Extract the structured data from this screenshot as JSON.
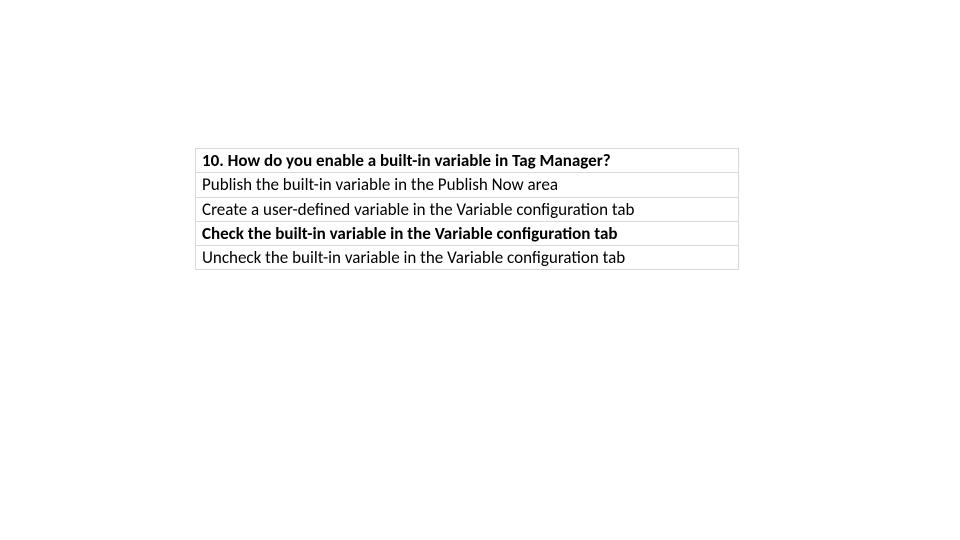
{
  "question": {
    "prompt": "10. How do you enable a built-in variable in Tag Manager?",
    "options": [
      {
        "text": "Publish the built-in variable in the Publish Now area",
        "bold": false
      },
      {
        "text": "Create a user-defined variable in the Variable configuration tab",
        "bold": false
      },
      {
        "text": "Check the built-in variable in the Variable configuration tab",
        "bold": true
      },
      {
        "text": "Uncheck the built-in variable in the Variable configuration tab",
        "bold": false
      }
    ]
  }
}
